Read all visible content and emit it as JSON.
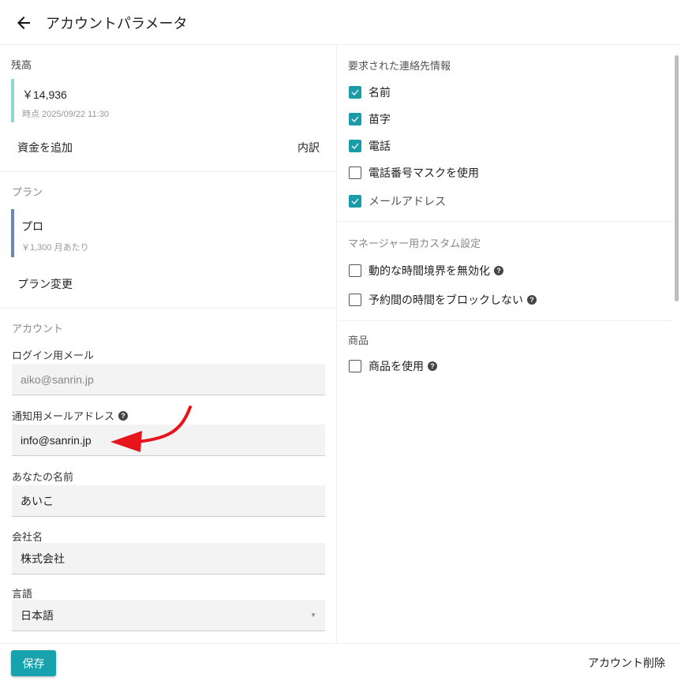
{
  "header": {
    "title": "アカウントパラメータ"
  },
  "balance": {
    "title": "残高",
    "amount": "￥14,936",
    "as_of": "時点 2025/09/22 11:30",
    "add_funds": "資金を追加",
    "breakdown": "内訳",
    "accent": "#8fd3db"
  },
  "plan": {
    "title": "プラン",
    "name": "プロ",
    "price": "￥1,300 月あたり",
    "change": "プラン変更",
    "accent": "#6a88b0"
  },
  "account": {
    "title": "アカウント",
    "login_email_label": "ログイン用メール",
    "login_email": "aiko@sanrin.jp",
    "notify_email_label": "通知用メールアドレス",
    "notify_email": "info@sanrin.jp",
    "name_label": "あなたの名前",
    "name": "あいこ",
    "company_label": "会社名",
    "company": "株式会社",
    "language_label": "言語",
    "language": "日本語"
  },
  "contact": {
    "title": "要求された連絡先情報",
    "items": [
      {
        "label": "名前",
        "checked": true
      },
      {
        "label": "苗字",
        "checked": true
      },
      {
        "label": "電話",
        "checked": true
      },
      {
        "label": "電話番号マスクを使用",
        "checked": false
      },
      {
        "label": "メールアドレス",
        "checked": true
      }
    ]
  },
  "manager": {
    "title": "マネージャー用カスタム設定",
    "items": [
      {
        "label": "動的な時間境界を無効化",
        "checked": false
      },
      {
        "label": "予約間の時間をブロックしない",
        "checked": false
      }
    ]
  },
  "products": {
    "title": "商品",
    "items": [
      {
        "label": "商品を使用",
        "checked": false
      }
    ]
  },
  "footer": {
    "save": "保存",
    "delete": "アカウント削除"
  },
  "colors": {
    "accent": "#1a9ca8",
    "annotation": "#e8141c"
  }
}
